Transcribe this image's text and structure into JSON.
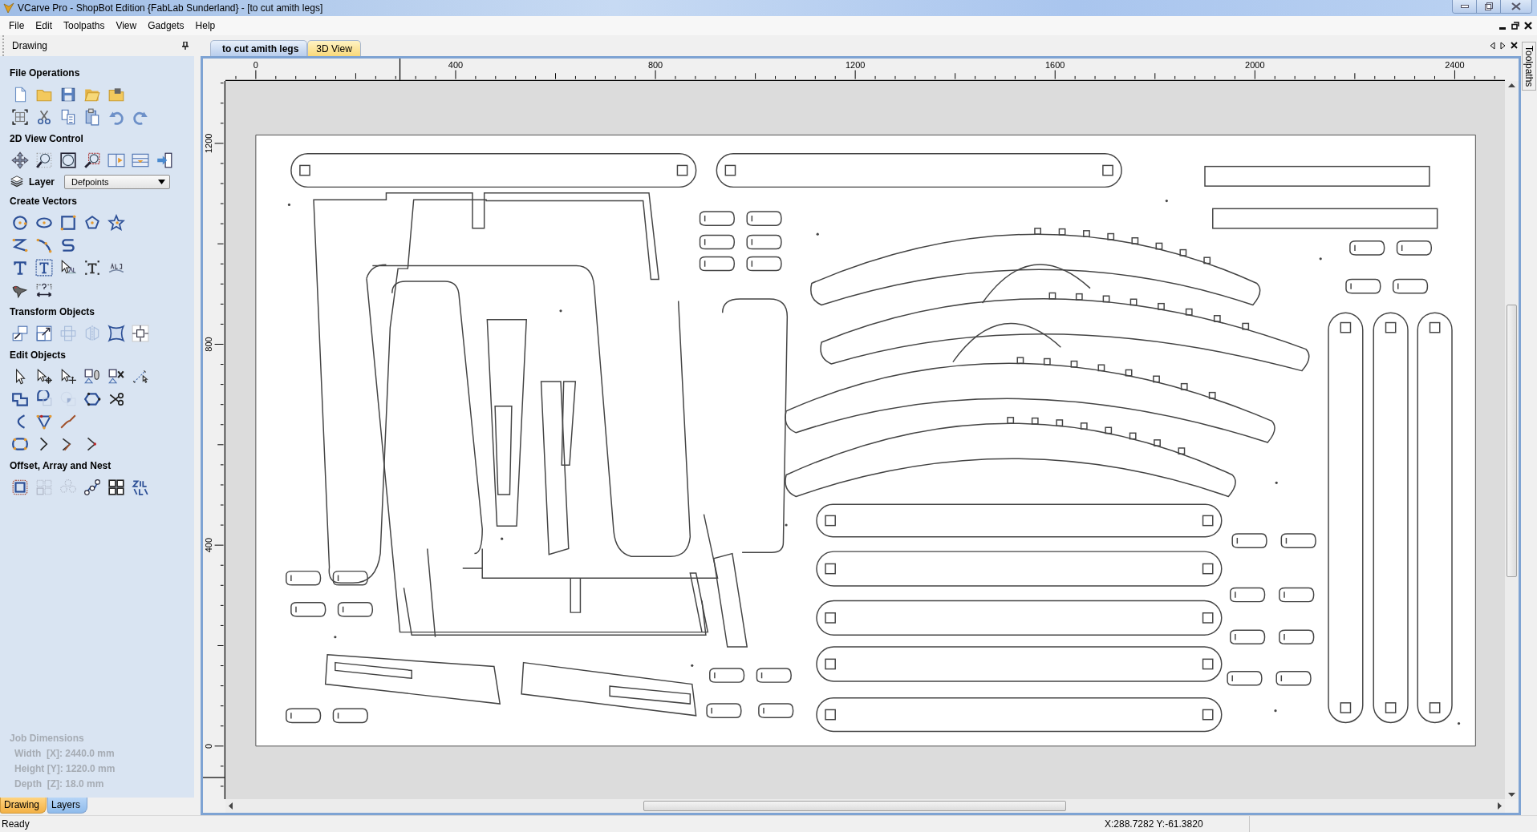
{
  "window": {
    "title": "VCarve Pro - ShopBot Edition {FabLab Sunderland} - [to cut amith legs]"
  },
  "menu": [
    "File",
    "Edit",
    "Toolpaths",
    "View",
    "Gadgets",
    "Help"
  ],
  "panel": {
    "title": "Drawing",
    "sections": [
      {
        "kind": "tools",
        "title": "File Operations",
        "rows": [
          [
            {
              "kind": "new-file",
              "disabled": false
            },
            {
              "kind": "open",
              "disabled": false
            },
            {
              "kind": "save",
              "disabled": false
            },
            {
              "kind": "open-folder",
              "disabled": false
            },
            {
              "kind": "import",
              "disabled": false
            }
          ],
          [
            {
              "kind": "select-all",
              "disabled": false
            },
            {
              "kind": "cut",
              "disabled": false
            },
            {
              "kind": "copy",
              "disabled": false
            },
            {
              "kind": "paste",
              "disabled": false
            },
            {
              "kind": "undo",
              "disabled": false
            },
            {
              "kind": "redo",
              "disabled": false
            }
          ]
        ]
      },
      {
        "kind": "tools",
        "title": "2D View Control",
        "rows": [
          [
            {
              "kind": "pan",
              "disabled": false
            },
            {
              "kind": "zoom",
              "disabled": false
            },
            {
              "kind": "zoom-extents",
              "disabled": false
            },
            {
              "kind": "zoom-window",
              "disabled": false
            },
            {
              "kind": "view-panel",
              "disabled": false
            },
            {
              "kind": "view-layout",
              "disabled": false
            },
            {
              "kind": "view-exit",
              "disabled": false
            }
          ]
        ]
      },
      {
        "kind": "layer",
        "label": "Layer",
        "value": "Defpoints"
      },
      {
        "kind": "tools",
        "title": "Create Vectors",
        "rows": [
          [
            {
              "kind": "circle",
              "disabled": false
            },
            {
              "kind": "ellipse",
              "disabled": false
            },
            {
              "kind": "rectangle",
              "disabled": false
            },
            {
              "kind": "polygon",
              "disabled": false
            },
            {
              "kind": "star",
              "disabled": false
            }
          ],
          [
            {
              "kind": "polyline",
              "disabled": false
            },
            {
              "kind": "curve",
              "disabled": false
            },
            {
              "kind": "s-curve",
              "disabled": false
            }
          ],
          [
            {
              "kind": "text",
              "disabled": false
            },
            {
              "kind": "text-box",
              "disabled": false
            },
            {
              "kind": "text-pointer",
              "disabled": false
            },
            {
              "kind": "text-auto",
              "disabled": false
            },
            {
              "kind": "arc-text",
              "disabled": false
            }
          ],
          [
            {
              "kind": "bitmap",
              "disabled": false
            },
            {
              "kind": "dimension",
              "disabled": false
            }
          ]
        ]
      },
      {
        "kind": "tools",
        "title": "Transform Objects",
        "rows": [
          [
            {
              "kind": "move",
              "disabled": false
            },
            {
              "kind": "scale",
              "disabled": false
            },
            {
              "kind": "align",
              "disabled": true
            },
            {
              "kind": "mirror",
              "disabled": true
            },
            {
              "kind": "distort",
              "disabled": false
            },
            {
              "kind": "center",
              "disabled": false
            }
          ]
        ]
      },
      {
        "kind": "tools",
        "title": "Edit Objects",
        "rows": [
          [
            {
              "kind": "select",
              "disabled": false
            },
            {
              "kind": "node-edit",
              "disabled": false
            },
            {
              "kind": "transform-select",
              "disabled": false
            },
            {
              "kind": "group",
              "disabled": false
            },
            {
              "kind": "ungroup",
              "disabled": false
            },
            {
              "kind": "measure",
              "disabled": false
            }
          ],
          [
            {
              "kind": "weld",
              "disabled": false
            },
            {
              "kind": "subtract",
              "disabled": false
            },
            {
              "kind": "intersect",
              "disabled": true
            },
            {
              "kind": "join",
              "disabled": false
            },
            {
              "kind": "trim",
              "disabled": false
            }
          ],
          [
            {
              "kind": "smooth",
              "disabled": false
            },
            {
              "kind": "fillet",
              "disabled": false
            },
            {
              "kind": "extend",
              "disabled": false
            }
          ],
          [
            {
              "kind": "close-vector",
              "disabled": false
            },
            {
              "kind": "node-a",
              "disabled": false
            },
            {
              "kind": "node-b",
              "disabled": false
            },
            {
              "kind": "node-c",
              "disabled": false
            }
          ]
        ]
      },
      {
        "kind": "tools",
        "title": "Offset, Array and Nest",
        "rows": [
          [
            {
              "kind": "offset",
              "disabled": false
            },
            {
              "kind": "array",
              "disabled": true
            },
            {
              "kind": "circular-array",
              "disabled": true
            },
            {
              "kind": "copy-along",
              "disabled": false
            },
            {
              "kind": "nest",
              "disabled": false
            },
            {
              "kind": "nest-text",
              "disabled": false
            }
          ]
        ]
      }
    ],
    "job_dimensions": {
      "title": "Job Dimensions",
      "lines": [
        "Width  [X]: 2440.0 mm",
        "Height [Y]: 1220.0 mm",
        "Depth  [Z]: 18.0 mm"
      ]
    },
    "tabs": [
      {
        "label": "Drawing",
        "selected": true
      },
      {
        "label": "Layers",
        "selected": false
      }
    ]
  },
  "document_tabs": [
    {
      "label": "to cut amith legs",
      "selected": true
    },
    {
      "label": "3D View",
      "selected": false
    }
  ],
  "rulers": {
    "horizontal": [
      "0",
      "400",
      "800",
      "1200",
      "1600",
      "2000",
      "2400"
    ],
    "vertical": [
      "0",
      "400",
      "800",
      "1200"
    ]
  },
  "side_tab": "Toolpaths",
  "status_bar": {
    "message": "Ready",
    "coordinates": "X:288.7282 Y:-61.3820"
  }
}
